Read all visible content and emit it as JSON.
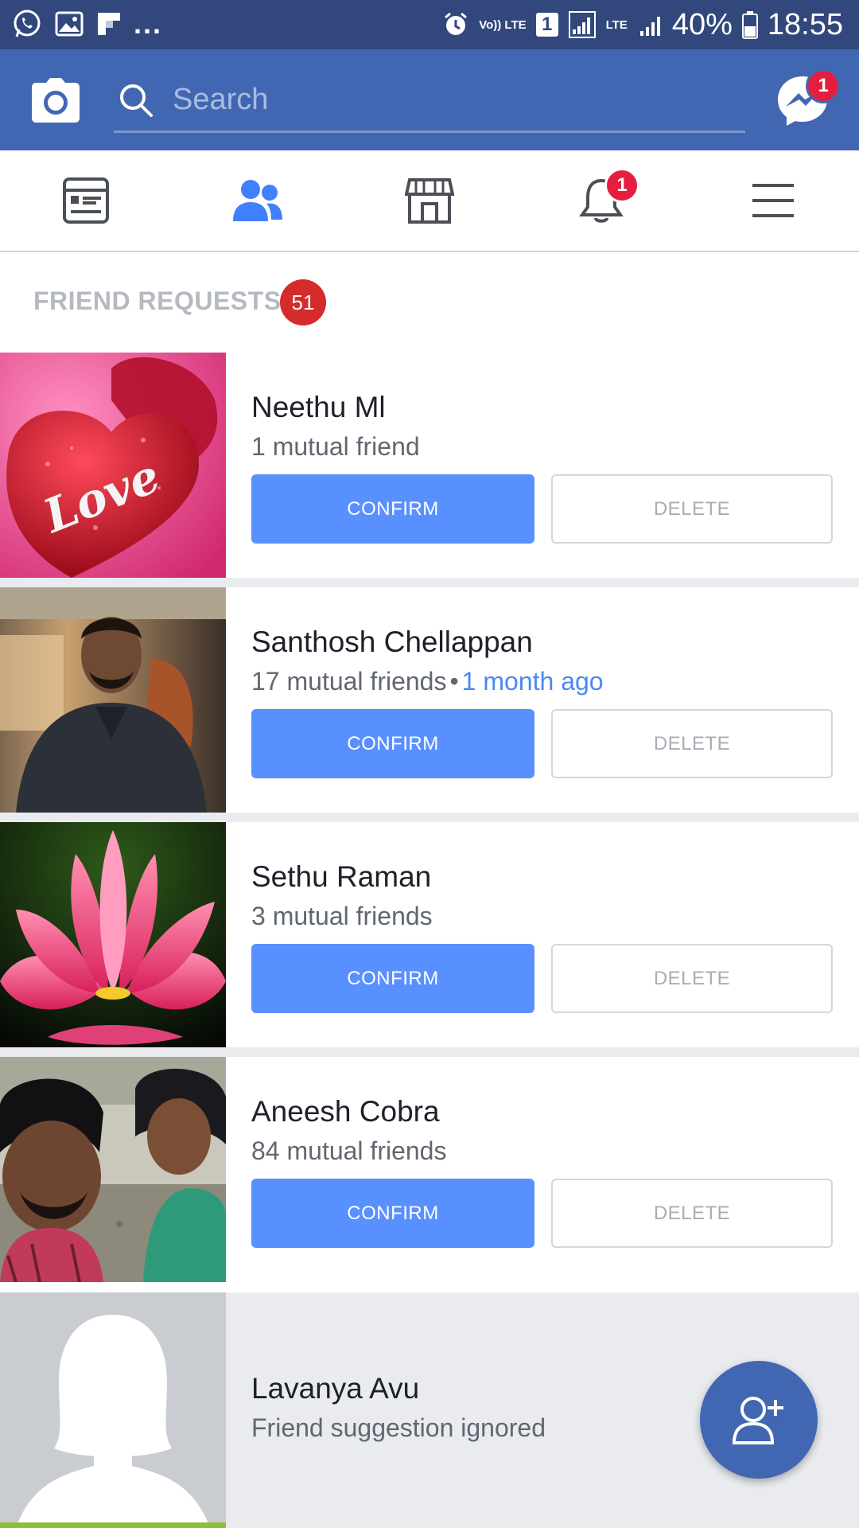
{
  "status_bar": {
    "signal_tags": [
      "Vo)) LTE",
      "LTE"
    ],
    "sim_number": "1",
    "battery": "40%",
    "time": "18:55",
    "overflow": "..."
  },
  "header": {
    "search": {
      "placeholder": "Search",
      "value": ""
    },
    "messenger_badge": "1"
  },
  "nav": {
    "tabs": [
      "news-feed",
      "friends",
      "marketplace",
      "notifications",
      "menu"
    ],
    "active_tab": "friends",
    "notifications_badge": "1"
  },
  "section": {
    "title": "FRIEND REQUESTS",
    "count": "51"
  },
  "requests": [
    {
      "name": "Neethu Ml",
      "mutual": "1 mutual friend",
      "time": "",
      "confirm_label": "CONFIRM",
      "delete_label": "DELETE",
      "avatar": "love-heart-photo"
    },
    {
      "name": "Santhosh Chellappan",
      "mutual": "17 mutual friends",
      "separator": "•",
      "time": "1 month ago",
      "confirm_label": "CONFIRM",
      "delete_label": "DELETE",
      "avatar": "man-portrait-photo"
    },
    {
      "name": "Sethu Raman",
      "mutual": "3 mutual friends",
      "time": "",
      "confirm_label": "CONFIRM",
      "delete_label": "DELETE",
      "avatar": "lotus-flower-photo"
    },
    {
      "name": "Aneesh Cobra",
      "mutual": "84 mutual friends",
      "time": "",
      "confirm_label": "CONFIRM",
      "delete_label": "DELETE",
      "avatar": "two-men-selfie-photo"
    }
  ],
  "ignored": {
    "name": "Lavanya Avu",
    "status": "Friend suggestion ignored",
    "avatar": "default-female-silhouette"
  },
  "fab": {
    "icon": "add-friend-icon"
  },
  "colors": {
    "header_blue": "#4267b2",
    "status_bar": "#32487c",
    "confirm_blue": "#5890ff",
    "badge_red": "#e41e3f",
    "link_blue": "#4a87f5"
  }
}
